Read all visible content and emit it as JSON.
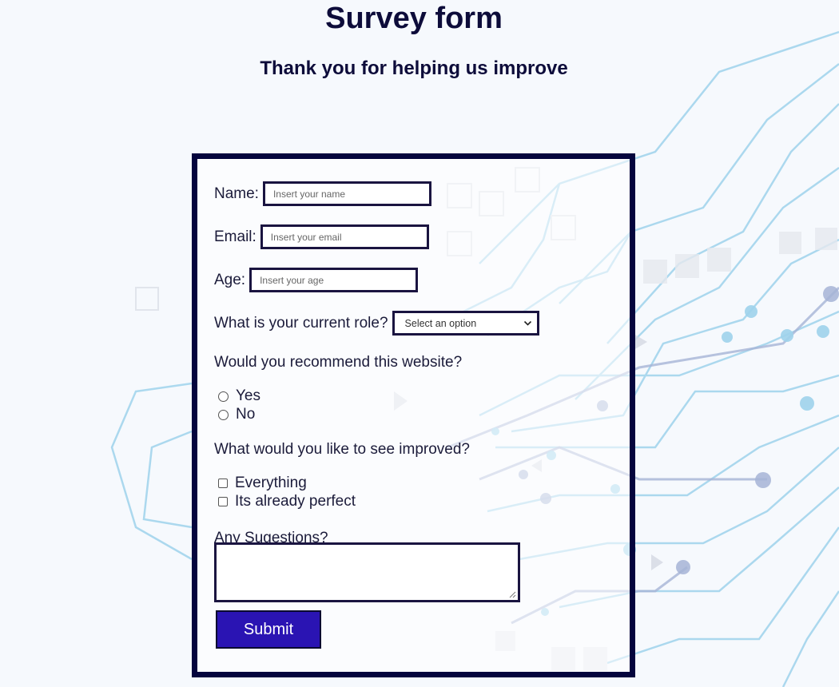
{
  "header": {
    "title": "Survey form",
    "subtitle": "Thank you for helping us improve"
  },
  "form": {
    "name": {
      "label": "Name:",
      "placeholder": "Insert your name",
      "value": ""
    },
    "email": {
      "label": "Email:",
      "placeholder": "Insert your email",
      "value": ""
    },
    "age": {
      "label": "Age:",
      "placeholder": "Insert your age",
      "value": ""
    },
    "role": {
      "label": "What is your current role?",
      "selected": "Select an option"
    },
    "recommend": {
      "question": "Would you recommend this website?",
      "options": [
        "Yes",
        "No"
      ]
    },
    "improve": {
      "question": "What would you like to see improved?",
      "options": [
        "Everything",
        "Its already perfect"
      ]
    },
    "suggestions": {
      "label": "Any Sugestions?",
      "value": ""
    },
    "submit_label": "Submit"
  },
  "colors": {
    "border": "#05053d",
    "submit_bg": "#2a14b3",
    "text": "#0d0c3a",
    "circuit_lines": "#8fcbe8"
  },
  "icons": {
    "select_arrow": "chevron-down-icon",
    "textarea_resize": "resize-grip-icon"
  }
}
